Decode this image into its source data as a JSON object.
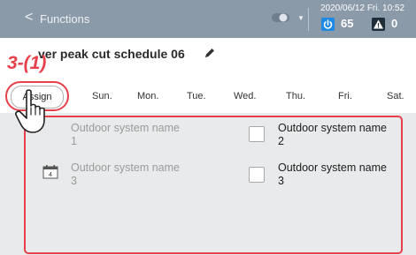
{
  "header": {
    "back_glyph": "<",
    "title": "Functions",
    "datetime": "2020/06/12 Fri. 10:52",
    "power_value": "65",
    "warning_value": "0",
    "icons": [
      "chevron-left-icon",
      "toggle-icon",
      "dropdown-arrow-icon",
      "power-icon",
      "warning-icon"
    ]
  },
  "schedule": {
    "title": "Power peak cut schedule 06",
    "title_visible": "ver peak cut schedule 06",
    "edit_icon": "pencil-icon"
  },
  "annotation": {
    "step_label": "3-(1)",
    "highlight_color": "#e8404a"
  },
  "days_row": {
    "assign_label": "Assign",
    "days": [
      "Sun.",
      "Mon.",
      "Tue.",
      "Wed.",
      "Thu.",
      "Fri.",
      "Sat."
    ]
  },
  "systems": [
    {
      "name_line1": "Outdoor system name",
      "name_line2": "1",
      "enabled": false
    },
    {
      "name_line1": "Outdoor system name",
      "name_line2": "2",
      "enabled": true,
      "checked": false
    },
    {
      "name_line1": "Outdoor system name",
      "name_line2": "3",
      "enabled": false,
      "calendar_icon_label": "4"
    },
    {
      "name_line1": "Outdoor system name",
      "name_line2": "3",
      "enabled": true,
      "checked": false
    }
  ],
  "colors": {
    "header_bg": "#8a9aa8",
    "power_icon": "#1e88e5",
    "warning_icon": "#1f2d38",
    "list_bg": "#e9eaeb"
  }
}
